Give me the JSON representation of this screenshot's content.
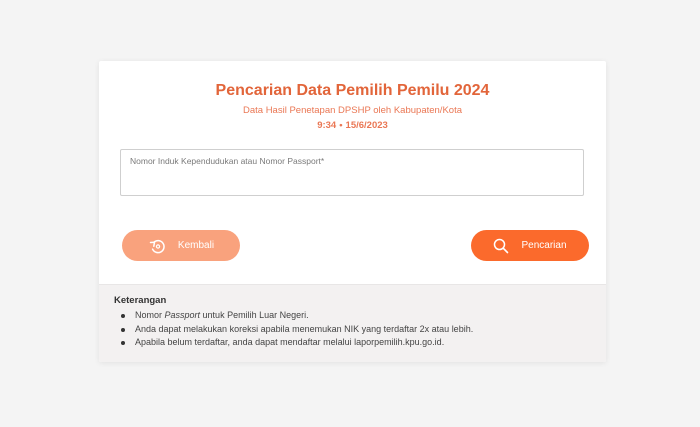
{
  "header": {
    "title": "Pencarian Data Pemilih Pemilu 2024",
    "subtitle": "Data Hasil Penetapan DPSHP oleh Kabupaten/Kota",
    "time": "9:34",
    "separator": "•",
    "date": "15/6/2023"
  },
  "form": {
    "field_label": "Nomor Induk Kependudukan atau Nomor Passport*",
    "field_value": ""
  },
  "buttons": {
    "back_label": "Kembali",
    "back_icon": "back-arrow-icon",
    "search_label": "Pencarian",
    "search_icon": "search-icon"
  },
  "info": {
    "title": "Keterangan",
    "item1_prefix": "Nomor ",
    "item1_italic": "Passport",
    "item1_suffix": " untuk Pemilih Luar Negeri.",
    "item2": "Anda dapat melakukan koreksi apabila menemukan NIK yang terdaftar 2x atau lebih.",
    "item3": "Apabila belum terdaftar, anda dapat mendaftar melalui laporpemilih.kpu.go.id."
  },
  "colors": {
    "accent": "#fb6a2c",
    "accent_light": "#f9a27d",
    "title": "#e2653a"
  }
}
